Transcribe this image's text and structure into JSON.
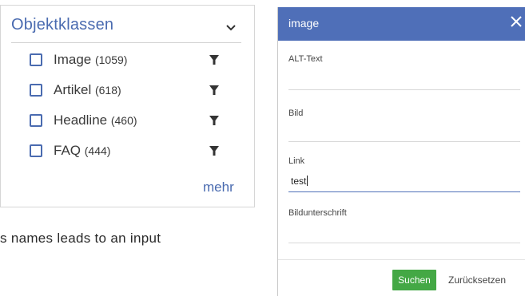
{
  "facet": {
    "title": "Objektklassen",
    "items": [
      {
        "label": "Image",
        "count": "(1059)"
      },
      {
        "label": "Artikel",
        "count": "(618)"
      },
      {
        "label": "Headline",
        "count": "(460)"
      },
      {
        "label": "FAQ",
        "count": "(444)"
      }
    ],
    "more": "mehr"
  },
  "stray_text": "s names leads to an input",
  "dialog": {
    "title": "image",
    "fields": [
      {
        "label": "ALT-Text",
        "value": ""
      },
      {
        "label": "Bild",
        "value": ""
      },
      {
        "label": "Link",
        "value": "test"
      },
      {
        "label": "Bildunterschrift",
        "value": ""
      }
    ],
    "search_label": "Suchen",
    "reset_label": "Zurücksetzen"
  },
  "colors": {
    "accent": "#4a6bb0",
    "dialog_header": "#4f6fb8",
    "search_button": "#44a845"
  },
  "icons": {
    "collapse": "chevron-down-icon",
    "filter": "filter-icon",
    "close": "close-icon"
  }
}
